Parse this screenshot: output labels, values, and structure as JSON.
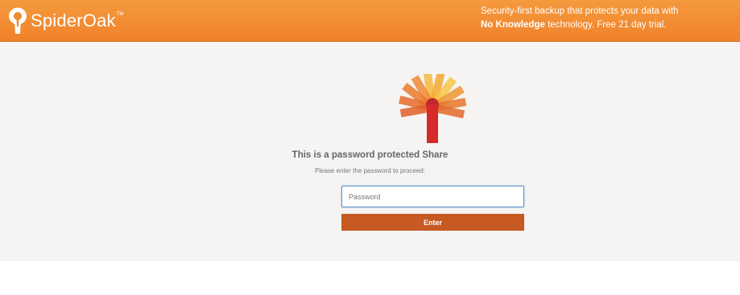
{
  "header": {
    "brand_name": "SpiderOak",
    "brand_tm": "TM",
    "tagline_line1": "Security-first backup that protects your data with",
    "tagline_bold": "No Knowledge",
    "tagline_line2_rest": " technology. Free 21 day trial."
  },
  "main": {
    "title": "This is a password protected Share",
    "subtitle": "Please enter the password to proceed:",
    "password_placeholder": "Password",
    "password_value": "",
    "enter_label": "Enter"
  },
  "colors": {
    "header_orange": "#f0822a",
    "button": "#c65a22",
    "logo_red": "#d42a2a"
  },
  "icons": {
    "brand": "spideroak-keyhole-tree-icon",
    "logo": "spideroak-tree-logo-icon"
  }
}
